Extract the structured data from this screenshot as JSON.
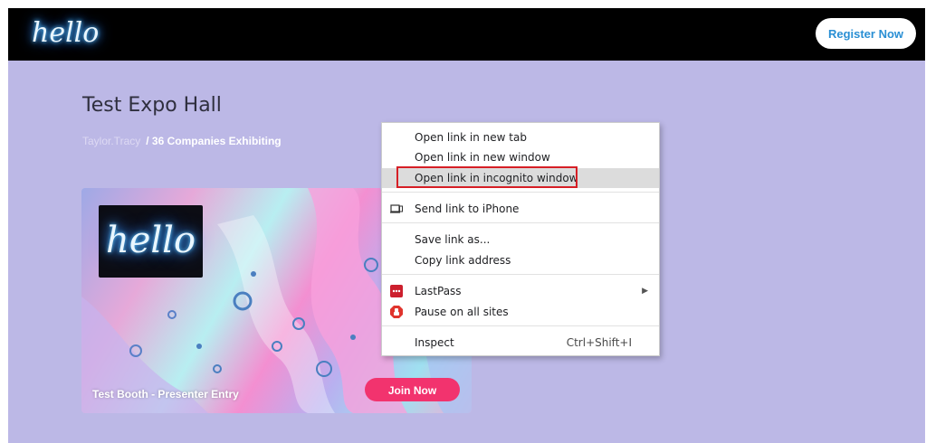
{
  "header": {
    "logo_text": "hello",
    "register_label": "Register Now"
  },
  "page": {
    "title": "Test Expo Hall",
    "organizer": "Taylor.Tracy",
    "companies": "/ 36 Companies Exhibiting"
  },
  "booth": {
    "logo_text": "hello",
    "name": "Test Booth - Presenter Entry",
    "join_label": "Join Now"
  },
  "context_menu": {
    "items": [
      {
        "label": "Open link in new tab"
      },
      {
        "label": "Open link in new window"
      },
      {
        "label": "Open link in incognito window",
        "highlighted": true
      },
      {
        "label": "Send link to iPhone",
        "icon": "device-icon"
      },
      {
        "label": "Save link as..."
      },
      {
        "label": "Copy link address"
      },
      {
        "label": "LastPass",
        "icon": "lastpass-icon",
        "submenu": true
      },
      {
        "label": "Pause on all sites",
        "icon": "adblock-icon"
      },
      {
        "label": "Inspect",
        "shortcut": "Ctrl+Shift+I"
      }
    ]
  },
  "colors": {
    "background": "#bcb8e6",
    "topbar": "#000000",
    "register_text": "#2a8fd4",
    "join_button": "#f2336e",
    "highlight_border": "#d61f26"
  }
}
